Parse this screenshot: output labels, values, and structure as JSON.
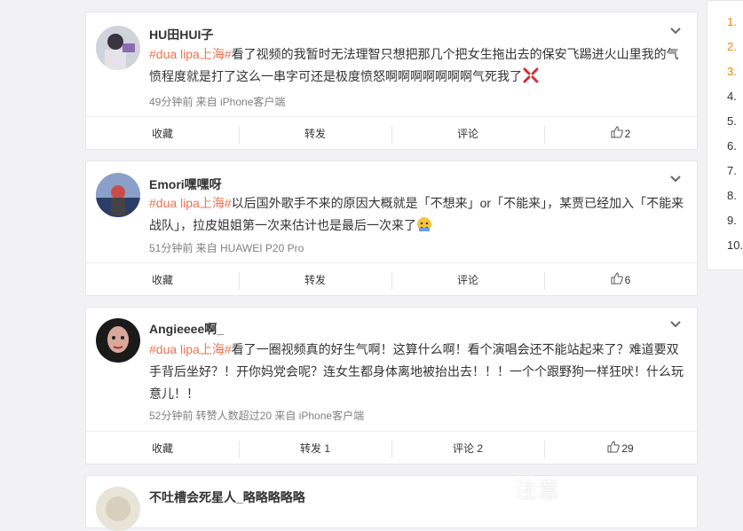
{
  "posts": [
    {
      "username": "HU田HUI子",
      "tag": "#dua lipa上海#",
      "body": "看了视频的我暂时无法理智只想把那几个把女生拖出去的保安飞踢进火山里我的气愤程度就是打了这么一串字可还是极度愤怒啊啊啊啊啊啊啊气死我了",
      "meta": "49分钟前 来自 iPhone客户端",
      "actions": {
        "favorite": "收藏",
        "repost": "转发",
        "comment": "评论",
        "like": "2"
      }
    },
    {
      "username": "Emori嘿嘿呀",
      "tag": "#dua lipa上海#",
      "body": "以后国外歌手不来的原因大概就是「不想来」or「不能来」，某贾已经加入「不能来战队」，拉皮姐姐第一次来估计也是最后一次来了",
      "meta": "51分钟前 来自 HUAWEI P20 Pro",
      "actions": {
        "favorite": "收藏",
        "repost": "转发",
        "comment": "评论",
        "like": "6"
      }
    },
    {
      "username": "Angieeee啊_",
      "tag": "#dua lipa上海#",
      "body": "看了一圈视频真的好生气啊！这算什么啊！看个演唱会还不能站起来了？难道要双手背后坐好？！开你妈党会呢？连女生都身体离地被抬出去！！！一个个跟野狗一样狂吠！什么玩意儿！！",
      "meta": "52分钟前 转赞人数超过20 来自 iPhone客户端",
      "actions": {
        "favorite": "收藏",
        "repost": "转发 1",
        "comment": "评论 2",
        "like": "29"
      }
    },
    {
      "username": "不吐槽会死星人_略略略略略"
    }
  ],
  "sidebar": {
    "items": [
      "1.",
      "2.",
      "3.",
      "4.",
      "5.",
      "6.",
      "7.",
      "8.",
      "9.",
      "10."
    ]
  },
  "watermark": "注意",
  "colors": {
    "tag": "#eb7350",
    "rank_hot": "#ff8200"
  },
  "icons": {
    "expand": "chevron-down-icon",
    "like": "thumb-up-icon",
    "angry": "anger-emoji-icon",
    "doge": "doge-emoji-icon"
  }
}
